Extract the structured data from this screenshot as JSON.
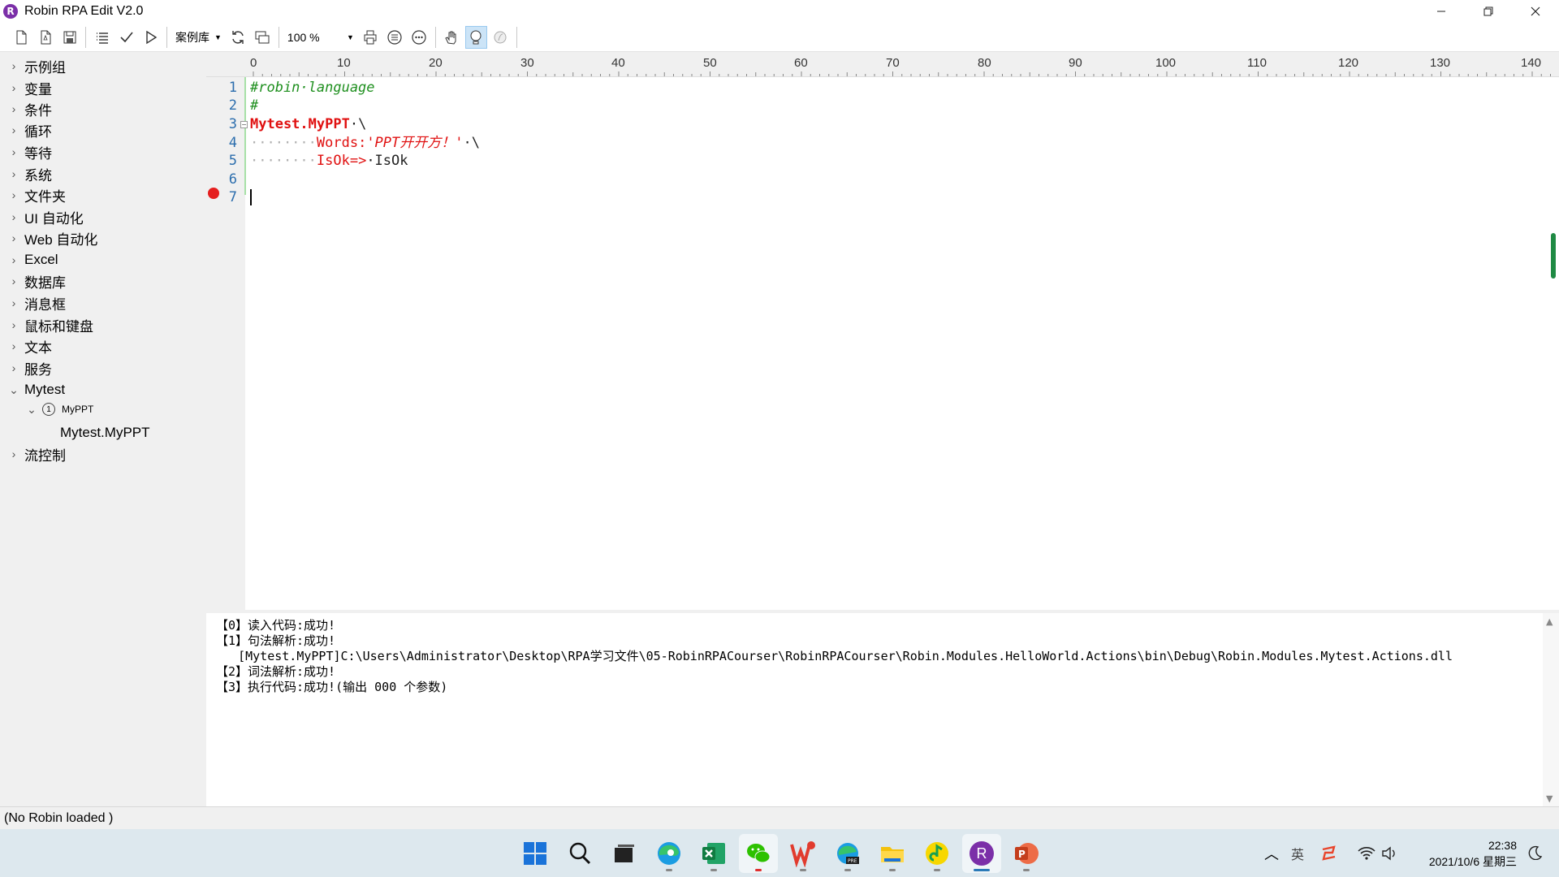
{
  "window": {
    "title": "Robin RPA Edit V2.0",
    "logo_letter": "R",
    "controls": [
      "minimize",
      "restore",
      "close"
    ]
  },
  "toolbar": {
    "buttons_left": [
      "new-file-icon",
      "new-doc-icon",
      "save-icon",
      "list-icon",
      "check-icon",
      "run-icon"
    ],
    "case_library_label": "案例库",
    "zoom_value": "100 %",
    "buttons_right": [
      "print-icon",
      "circle-list-icon",
      "circle-dots-icon",
      "hand-icon",
      "gesture-icon",
      "disabled-icon"
    ]
  },
  "sidebar": {
    "items": [
      {
        "label": "示例组",
        "expanded": false
      },
      {
        "label": "变量",
        "expanded": false
      },
      {
        "label": "条件",
        "expanded": false
      },
      {
        "label": "循环",
        "expanded": false
      },
      {
        "label": "等待",
        "expanded": false
      },
      {
        "label": "系统",
        "expanded": false
      },
      {
        "label": "文件夹",
        "expanded": false
      },
      {
        "label": "UI 自动化",
        "expanded": false
      },
      {
        "label": "Web 自动化",
        "expanded": false
      },
      {
        "label": "Excel",
        "expanded": false
      },
      {
        "label": "数据库",
        "expanded": false
      },
      {
        "label": "消息框",
        "expanded": false
      },
      {
        "label": "鼠标和键盘",
        "expanded": false
      },
      {
        "label": "文本",
        "expanded": false
      },
      {
        "label": "服务",
        "expanded": false
      },
      {
        "label": "Mytest",
        "expanded": true
      },
      {
        "label": "MyPPT",
        "expanded": true
      },
      {
        "label": "Mytest.MyPPT",
        "expanded": false
      },
      {
        "label": "流控制",
        "expanded": false
      }
    ]
  },
  "ruler": {
    "labels": [
      "0",
      "10",
      "20",
      "30",
      "40",
      "50",
      "60",
      "70",
      "80",
      "90",
      "100",
      "110",
      "120",
      "130",
      "140"
    ]
  },
  "editor": {
    "line_numbers": [
      "1",
      "2",
      "3",
      "4",
      "5",
      "6",
      "7"
    ],
    "breakpoint_line": "7",
    "code": {
      "l1": "#robin·language",
      "l2": "#",
      "l3_obj": "Mytest.MyPPT",
      "l3_cont": "·\\",
      "l4_ws": "········",
      "l4_key": "Words:",
      "l4_val": "'PPT开开方！'",
      "l4_cont": "·\\",
      "l5_ws": "········",
      "l5_key": "IsOk=>",
      "l5_val": "·IsOk"
    }
  },
  "output": {
    "lines": [
      "【0】读入代码:成功!",
      "【1】句法解析:成功!",
      "   [Mytest.MyPPT]C:\\Users\\Administrator\\Desktop\\RPA学习文件\\05-RobinRPACourser\\RobinRPACourser\\Robin.Modules.HelloWorld.Actions\\bin\\Debug\\Robin.Modules.Mytest.Actions.dll",
      "【2】词法解析:成功!",
      "【3】执行代码:成功!(输出 000 个参数)"
    ]
  },
  "status": {
    "text": "(No Robin loaded )"
  },
  "taskbar": {
    "apps": [
      "windows-start-icon",
      "search-icon",
      "task-view-icon",
      "edge-icon",
      "excel-icon",
      "wechat-icon",
      "wps-icon",
      "edge-pre-icon",
      "file-explorer-icon",
      "music-icon",
      "robin-icon",
      "powerpoint-icon"
    ],
    "robin_letter": "R",
    "time": "22:38",
    "date": "2021/10/6 星期三",
    "ime_label": "英"
  }
}
